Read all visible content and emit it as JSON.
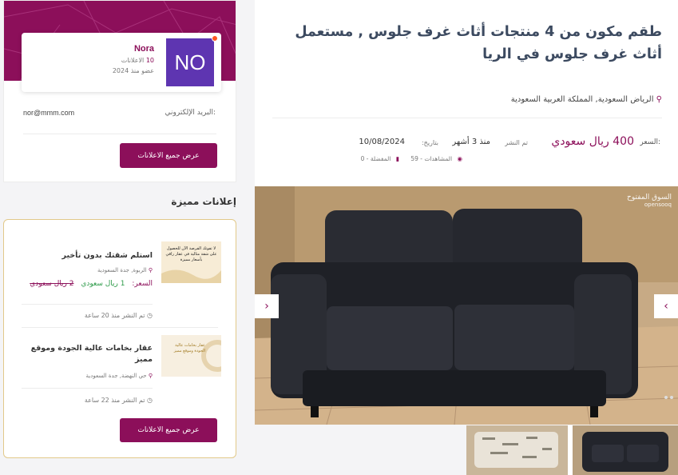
{
  "seller": {
    "name": "Nora",
    "avatar_initials": "NO",
    "ads_count": "10",
    "ads_label": "الاعلانات",
    "member_since": "عضو منذ 2024",
    "email_label": "البريد الإلكتروني:",
    "email": "nor@mmm.com",
    "view_all_label": "عرض جميع الاعلانات"
  },
  "featured": {
    "title": "إعلانات مميزة",
    "items": [
      {
        "title": "استلم شقتك بدون تأخير",
        "location": "الربوة, جدة السعودية",
        "price_label": "السعر:",
        "price": "1 ريال سعودي",
        "old_price": "2 ريال سعودي",
        "posted": "تم النشر منذ 20 ساعة",
        "thumb_text": "لا تفوتك الفرصة الآن للحصول على شقة مثالية في عقار راقي بأسعار مميزة"
      },
      {
        "title": "عقار بخامات عالية الجودة وموقع مميز",
        "location": "حي النهضة, جدة السعودية",
        "posted": "تم النشر منذ 22 ساعة",
        "thumb_text": "عقار بخامات عالية الجودة وموقع مميز"
      }
    ],
    "view_all_label": "عرض جميع الاعلانات"
  },
  "ad": {
    "title": "طقم مكون من 4 منتجات أثاث غرف جلوس , مستعمل أثاث غرف جلوس في الريا",
    "location": "الرياض السعودية, المملكة العربية السعودية",
    "price_label": "السعر:",
    "price": "400 ريال سعودي",
    "posted_label": "تم النشر",
    "posted": "منذ 3 أشهر",
    "posted_date_label": "بتاريخ:",
    "posted_date": "10/08/2024",
    "views": "المشاهدات - 59",
    "favorites": "المفضلة - 0"
  },
  "gallery": {
    "watermark_title": "السوق المفتوح",
    "watermark_sub": "opensooq"
  },
  "colors": {
    "brand": "#8c0f5a",
    "title": "#3c4a60",
    "featured_border": "#e2c98a",
    "avatar": "#5e35b1"
  },
  "icons": [
    "map-pin-icon",
    "eye-icon",
    "bookmark-icon",
    "clock-icon",
    "chevron-left-icon",
    "chevron-right-icon"
  ]
}
